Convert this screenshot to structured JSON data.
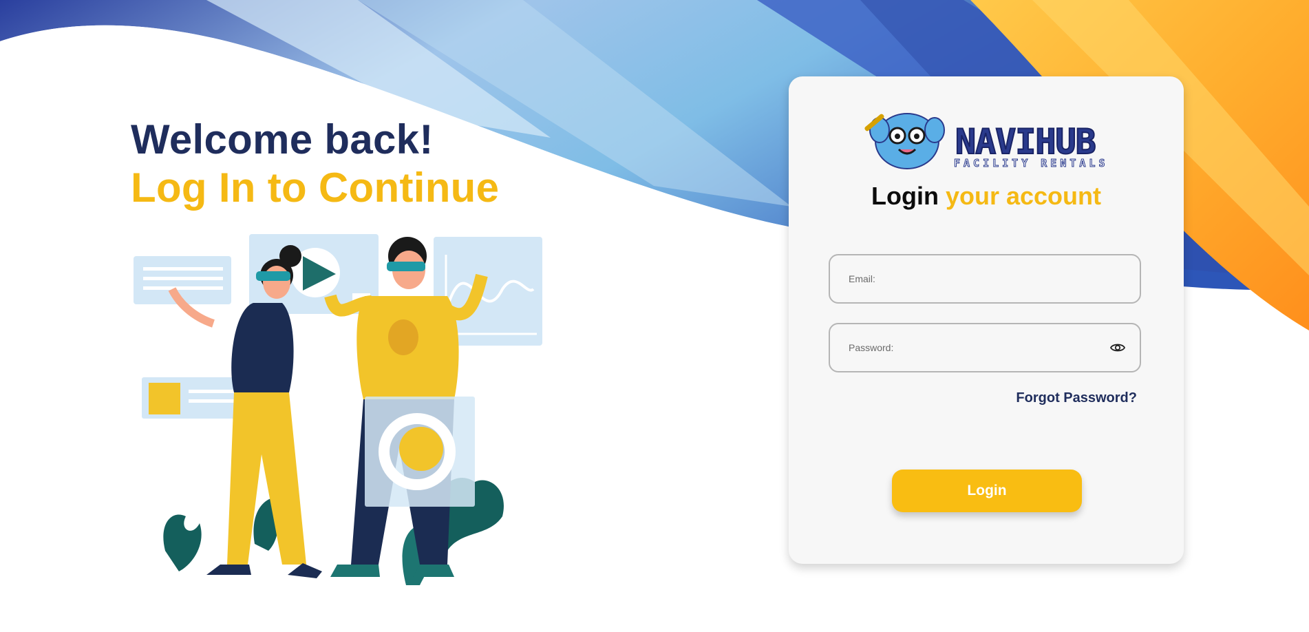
{
  "hero": {
    "line1": "Welcome back!",
    "line2": "Log In to Continue"
  },
  "card": {
    "logo": {
      "name": "NAVIHUB",
      "tagline": "FACILITY RENTALS"
    },
    "title_dark": "Login",
    "title_gold": "your account",
    "email": {
      "placeholder": "Email:",
      "value": ""
    },
    "password": {
      "placeholder": "Password:",
      "value": "",
      "toggle_icon": "eye-icon"
    },
    "forgot_label": "Forgot Password?",
    "login_label": "Login"
  },
  "colors": {
    "navy": "#1f2d5c",
    "gold": "#f5b914",
    "button": "#f9bd12",
    "card_bg": "#f7f7f7"
  }
}
